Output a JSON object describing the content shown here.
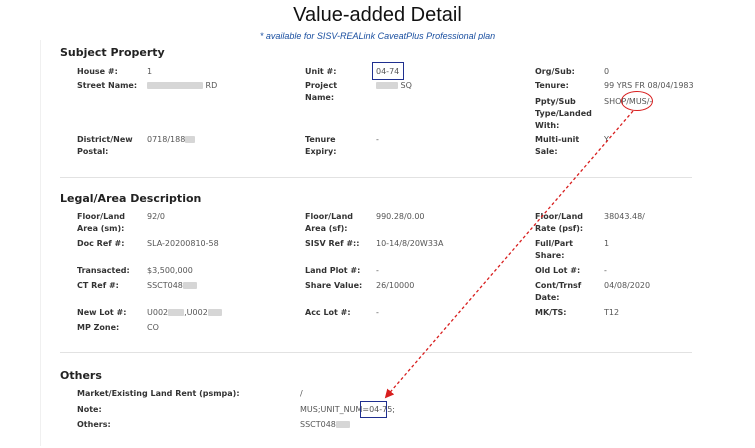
{
  "header": {
    "title": "Value-added Detail",
    "subtitle_link": "* available for SISV-REALink CaveatPlus Professional plan"
  },
  "subject_property": {
    "title": "Subject Property",
    "house_label": "House #:",
    "house_value": "1",
    "unit_label": "Unit #:",
    "unit_value": "04-74",
    "org_sub_label": "Org/Sub:",
    "org_sub_value": "0",
    "street_label": "Street Name:",
    "street_value_suffix": "RD",
    "project_label": "Project Name:",
    "project_value_suffix": "SQ",
    "tenure_label": "Tenure:",
    "tenure_value": "99 YRS FR 08/04/1983",
    "ppty_label": "Ppty/Sub Type/Landed With:",
    "ppty_value_a": "SHOP",
    "ppty_value_b": "/MUS/-",
    "district_label": "District/New Postal:",
    "district_value": "0718/188",
    "tenure_expiry_label": "Tenure Expiry:",
    "tenure_expiry_value": "-",
    "multi_unit_label": "Multi-unit Sale:",
    "multi_unit_value": "Y"
  },
  "legal_area": {
    "title": "Legal/Area Description",
    "floor_land_sm_label": "Floor/Land Area (sm):",
    "floor_land_sm_value": "92/0",
    "floor_land_sf_label": "Floor/Land Area (sf):",
    "floor_land_sf_value": "990.28/0.00",
    "floor_land_rate_label": "Floor/Land Rate (psf):",
    "floor_land_rate_value": "38043.48/",
    "doc_ref_label": "Doc Ref #:",
    "doc_ref_value": "SLA-20200810-58",
    "sisv_ref_label": "SISV Ref #::",
    "sisv_ref_value": "10-14/8/20W33A",
    "full_part_label": "Full/Part Share:",
    "full_part_value": "1",
    "transacted_label": "Transacted:",
    "transacted_value": "$3,500,000",
    "land_plot_label": "Land Plot #:",
    "land_plot_value": "-",
    "old_lot_label": "Old Lot #:",
    "old_lot_value": "-",
    "ct_ref_label": "CT Ref #:",
    "ct_ref_value": "SSCT048",
    "share_value_label": "Share Value:",
    "share_value_value": "26/10000",
    "cont_trnsf_label": "Cont/Trnsf Date:",
    "cont_trnsf_value": "04/08/2020",
    "new_lot_label": "New Lot #:",
    "new_lot_value_a": "U002",
    "new_lot_value_b": ",U002",
    "acc_lot_label": "Acc Lot #:",
    "acc_lot_value": "-",
    "mk_ts_label": "MK/TS:",
    "mk_ts_value": "T12",
    "mp_zone_label": "MP Zone:",
    "mp_zone_value": "CO"
  },
  "others": {
    "title": "Others",
    "market_rent_label": "Market/Existing Land Rent (psmpa):",
    "market_rent_value": "/",
    "note_label": "Note:",
    "note_value_prefix": "MUS;UNIT_NUM=",
    "note_value_unit": "04-75;",
    "others_label": "Others:",
    "others_value": "SSCT048"
  },
  "colors": {
    "highlight_box": "#1f2f8f",
    "highlight_circle": "#d81e1e",
    "arrow": "#d81e1e",
    "link": "#1a4fa0"
  }
}
